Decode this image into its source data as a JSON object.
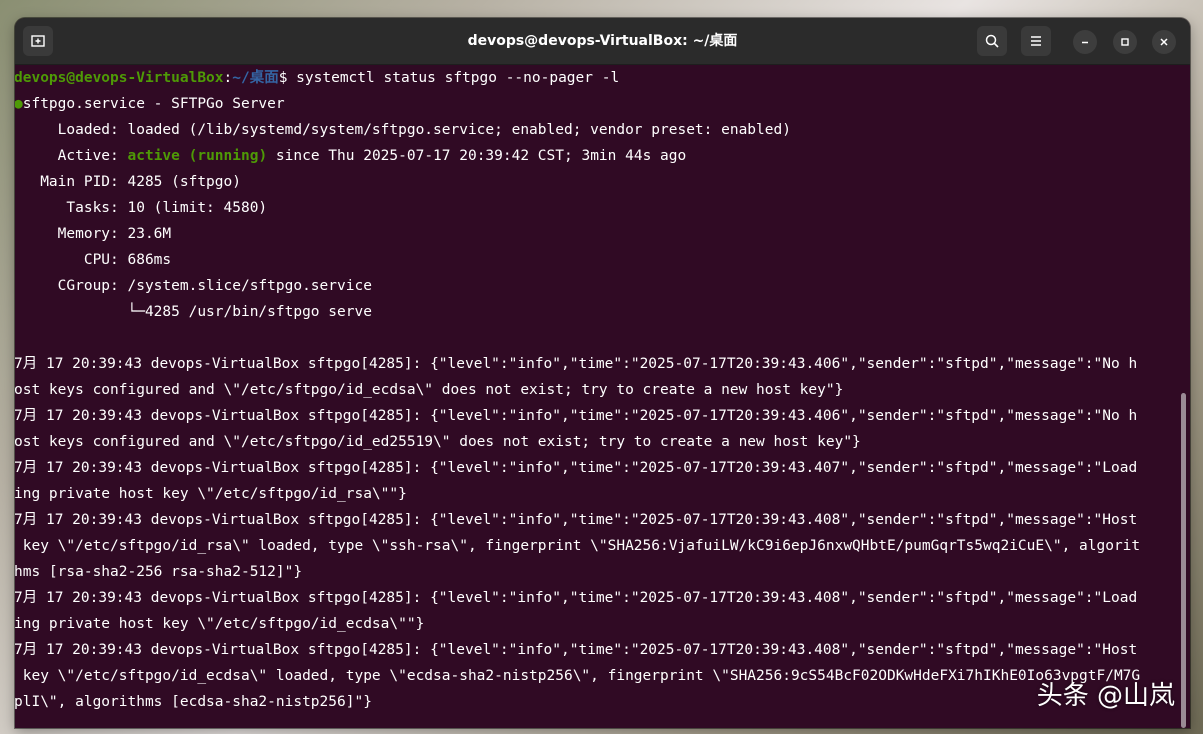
{
  "window": {
    "title": "devops@devops-VirtualBox: ~/桌面"
  },
  "titlebar_icons": {
    "new_tab": "new-tab-icon",
    "search": "search-icon",
    "menu": "hamburger-menu-icon",
    "minimize": "minimize-icon",
    "maximize": "maximize-icon",
    "close": "close-icon"
  },
  "prompt": {
    "user_host": "devops@devops-VirtualBox",
    "separator": ":",
    "path": "~/桌面",
    "symbol": "$",
    "command": " systemctl status sftpgo --no-pager -l"
  },
  "status": {
    "dot": "●",
    "header": "sftpgo.service - SFTPGo Server",
    "loaded": "     Loaded: loaded (/lib/systemd/system/sftpgo.service; enabled; vendor preset: enabled)",
    "active_label": "     Active: ",
    "active_state": "active (running)",
    "active_since": " since Thu 2025-07-17 20:39:42 CST; 3min 44s ago",
    "main_pid": "   Main PID: 4285 (sftpgo)",
    "tasks": "      Tasks: 10 (limit: 4580)",
    "memory": "     Memory: 23.6M",
    "cpu": "        CPU: 686ms",
    "cgroup": "     CGroup: /system.slice/sftpgo.service",
    "cgroup_child": "             └─4285 /usr/bin/sftpgo serve"
  },
  "log_lines": [
    "7月 17 20:39:43 devops-VirtualBox sftpgo[4285]: {\"level\":\"info\",\"time\":\"2025-07-17T20:39:43.406\",\"sender\":\"sftpd\",\"message\":\"No h",
    "ost keys configured and \\\"/etc/sftpgo/id_ecdsa\\\" does not exist; try to create a new host key\"}",
    "7月 17 20:39:43 devops-VirtualBox sftpgo[4285]: {\"level\":\"info\",\"time\":\"2025-07-17T20:39:43.406\",\"sender\":\"sftpd\",\"message\":\"No h",
    "ost keys configured and \\\"/etc/sftpgo/id_ed25519\\\" does not exist; try to create a new host key\"}",
    "7月 17 20:39:43 devops-VirtualBox sftpgo[4285]: {\"level\":\"info\",\"time\":\"2025-07-17T20:39:43.407\",\"sender\":\"sftpd\",\"message\":\"Load",
    "ing private host key \\\"/etc/sftpgo/id_rsa\\\"\"}",
    "7月 17 20:39:43 devops-VirtualBox sftpgo[4285]: {\"level\":\"info\",\"time\":\"2025-07-17T20:39:43.408\",\"sender\":\"sftpd\",\"message\":\"Host",
    " key \\\"/etc/sftpgo/id_rsa\\\" loaded, type \\\"ssh-rsa\\\", fingerprint \\\"SHA256:VjafuiLW/kC9i6epJ6nxwQHbtE/pumGqrTs5wq2iCuE\\\", algorit",
    "hms [rsa-sha2-256 rsa-sha2-512]\"}",
    "7月 17 20:39:43 devops-VirtualBox sftpgo[4285]: {\"level\":\"info\",\"time\":\"2025-07-17T20:39:43.408\",\"sender\":\"sftpd\",\"message\":\"Load",
    "ing private host key \\\"/etc/sftpgo/id_ecdsa\\\"\"}",
    "7月 17 20:39:43 devops-VirtualBox sftpgo[4285]: {\"level\":\"info\",\"time\":\"2025-07-17T20:39:43.408\",\"sender\":\"sftpd\",\"message\":\"Host",
    " key \\\"/etc/sftpgo/id_ecdsa\\\" loaded, type \\\"ecdsa-sha2-nistp256\\\", fingerprint \\\"SHA256:9cS54BcF02ODKwHdeFXi7hIKhE0Io63vpgtF/M7G",
    "plI\\\", algorithms [ecdsa-sha2-nistp256]\"}"
  ],
  "watermark": "头条 @山岚"
}
